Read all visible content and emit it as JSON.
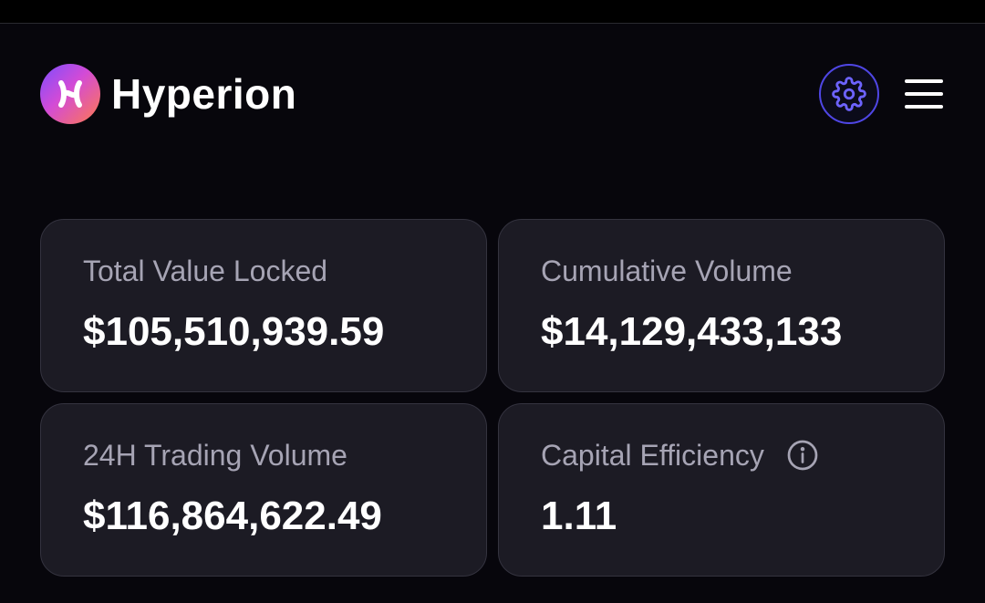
{
  "app": {
    "brand_name": "Hyperion"
  },
  "header": {
    "settings_icon": "gear-icon",
    "menu_icon": "hamburger-menu-icon"
  },
  "stats": [
    {
      "label": "Total Value Locked",
      "value": "$105,510,939.59"
    },
    {
      "label": "Cumulative Volume",
      "value": "$14,129,433,133"
    },
    {
      "label": "24H Trading Volume",
      "value": "$116,864,622.49"
    },
    {
      "label": "Capital Efficiency",
      "value": "1.11",
      "icon": "info-icon"
    }
  ],
  "colors": {
    "background": "#07060c",
    "card_background": "#1c1b24",
    "card_border": "#34333f",
    "accent": "#4f46e5",
    "label_text": "#a6a4b4",
    "value_text": "#ffffff"
  }
}
